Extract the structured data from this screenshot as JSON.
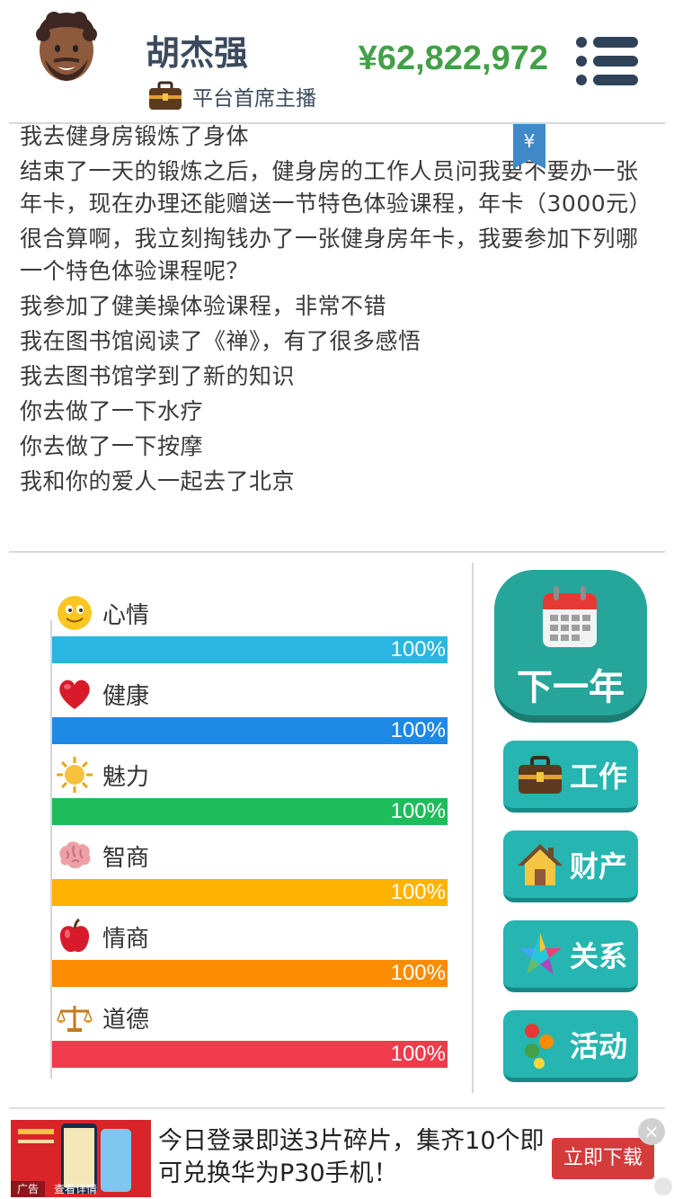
{
  "header": {
    "name": "胡杰强",
    "title": "平台首席主播",
    "money": "¥62,822,972",
    "menu_icon": "menu-icon"
  },
  "log": {
    "tag": "¥",
    "lines": [
      "我去健身房锻炼了身体",
      "结束了一天的锻炼之后，健身房的工作人员问我要不要办一张年卡，现在办理还能赠送一节特色体验课程，年卡（3000元）",
      "很合算啊，我立刻掏钱办了一张健身房年卡，我要参加下列哪一个特色体验课程呢？",
      "我参加了健美操体验课程，非常不错",
      "我在图书馆阅读了《禅》，有了很多感悟",
      "我去图书馆学到了新的知识",
      "你去做了一下水疗",
      "你去做了一下按摩",
      "我和你的爱人一起去了北京"
    ]
  },
  "stats": [
    {
      "label": "心情",
      "value": "100%",
      "level": 1.0,
      "color": "#29b6e0",
      "icon": "smiley-icon"
    },
    {
      "label": "健康",
      "value": "100%",
      "level": 1.0,
      "color": "#1e88e5",
      "icon": "heart-icon"
    },
    {
      "label": "魅力",
      "value": "100%",
      "level": 1.0,
      "color": "#1ebd5a",
      "icon": "sun-icon"
    },
    {
      "label": "智商",
      "value": "100%",
      "level": 1.0,
      "color": "#ffb300",
      "icon": "brain-icon"
    },
    {
      "label": "情商",
      "value": "100%",
      "level": 1.0,
      "color": "#fb8c00",
      "icon": "apple-icon"
    },
    {
      "label": "道德",
      "value": "100%",
      "level": 1.0,
      "color": "#ef3b4b",
      "icon": "scales-icon"
    }
  ],
  "actions": {
    "next_year": "下一年",
    "work": "工作",
    "property": "财产",
    "relations": "关系",
    "activities": "活动"
  },
  "ad": {
    "text": "今日登录即送3片碎片，集齐10个即可兑换华为P30手机！",
    "cta": "立即下载",
    "close": "×",
    "badge": "广告",
    "small": "查看详情"
  }
}
